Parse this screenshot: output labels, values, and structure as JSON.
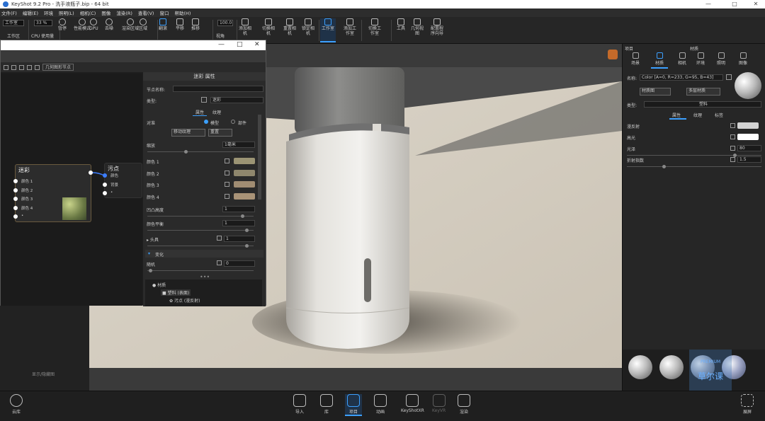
{
  "window": {
    "title": "KeyShot 9.2 Pro - 洗手液瓶子.bip - 64 bit"
  },
  "menu": [
    "文件(F)",
    "编辑(E)",
    "环境",
    "照明(L)",
    "相机(C)",
    "图像",
    "渲染(R)",
    "查看(V)",
    "窗口",
    "帮助(H)"
  ],
  "toolbar": {
    "workspace_label": "工作室",
    "workspace_value": "工作区",
    "cpu_value": "33 %",
    "cpu_label": "CPU 使用量",
    "items": [
      {
        "label": "暂停",
        "icon": "pause-icon"
      },
      {
        "label": "性能模式",
        "icon": "performance-icon"
      },
      {
        "label": "GPU",
        "icon": "gpu-icon"
      },
      {
        "label": "去噪",
        "icon": "denoise-icon"
      },
      {
        "label": "渲染区域",
        "icon": "region-icon"
      },
      {
        "label": "区域",
        "icon": "area-icon"
      },
      {
        "label": "翻滚",
        "icon": "tumble-icon"
      },
      {
        "label": "平移",
        "icon": "pan-icon"
      },
      {
        "label": "推移",
        "icon": "dolly-icon"
      }
    ],
    "fov_value": "100.0",
    "fov_label": "视角",
    "items2": [
      {
        "label": "添加相机",
        "icon": "add-camera-icon"
      },
      {
        "label": "切换相机",
        "icon": "switch-camera-icon"
      },
      {
        "label": "重置相机",
        "icon": "reset-camera-icon"
      },
      {
        "label": "锁定相机",
        "icon": "lock-camera-icon"
      },
      {
        "label": "工作室",
        "icon": "studio-icon"
      },
      {
        "label": "添加工作室",
        "icon": "add-studio-icon"
      },
      {
        "label": "切换工作室",
        "icon": "switch-studio-icon"
      },
      {
        "label": "工具",
        "icon": "tools-icon"
      },
      {
        "label": "几何视图",
        "icon": "geometry-view-icon"
      },
      {
        "label": "配置程序向导",
        "icon": "configurator-icon"
      }
    ]
  },
  "node_window": {
    "toolbar_label": "几何图形节点",
    "node_main": {
      "title": "迷彩",
      "ports": [
        "颜色 1",
        "颜色 2",
        "颜色 3",
        "颜色 4",
        "•"
      ]
    },
    "node_out": {
      "title": "污点",
      "ports": [
        "颜色",
        "背景",
        "•"
      ]
    },
    "footer": "显示/隐藏图"
  },
  "props": {
    "header": "迷彩 属性",
    "node_name_label": "节点名称:",
    "type_label": "类型:",
    "type_value": "迷彩",
    "tabs": [
      "属性",
      "纹理"
    ],
    "map_label": "对准",
    "radio1": "模型",
    "radio2": "部件",
    "move_btn": "移动纹理",
    "reset_btn": "重置",
    "scale_label": "缩放",
    "scale_value": "1毫米",
    "colors": [
      {
        "label": "颜色 1",
        "hex": "#9b9474"
      },
      {
        "label": "颜色 2",
        "hex": "#8f876d"
      },
      {
        "label": "颜色 3",
        "hex": "#a08c72"
      },
      {
        "label": "颜色 4",
        "hex": "#a99377"
      }
    ],
    "bump_label": "凹凸高度",
    "bump_value": "1",
    "color_balance_label": "颜色平衡",
    "color_balance_value": "1",
    "block_label": "▸ 头具",
    "block_value": "1",
    "change_label": "变化",
    "change_sub": "随机",
    "change_value": "0",
    "tree": [
      "材质",
      "塑料 (表面)",
      "污点 (漫反射)"
    ]
  },
  "right": {
    "header_left": "项目",
    "header_title": "材质",
    "tabs": [
      "场景",
      "材质",
      "相机",
      "环境",
      "照明",
      "图像"
    ],
    "name_label": "名称:",
    "name_value": "Color [A=0, R=233, G=95, B=43]",
    "btn1": "材质图",
    "btn2": "多层材质",
    "type_label": "类型:",
    "type_value": "塑料",
    "subtabs": [
      "属性",
      "纹理",
      "标签"
    ],
    "rows": [
      {
        "label": "漫反射",
        "value": ""
      },
      {
        "label": "高光",
        "value": ""
      },
      {
        "label": "光泽",
        "value": "80"
      },
      {
        "label": "折射指数",
        "value": "1.5"
      }
    ],
    "diffuse_color": "#d3d3d3",
    "specular_color": "#ffffff"
  },
  "bottom": {
    "left_label": "云库",
    "right_label": "展屏",
    "items": [
      {
        "label": "导入",
        "icon": "import-icon"
      },
      {
        "label": "库",
        "icon": "library-icon"
      },
      {
        "label": "项目",
        "icon": "project-icon"
      },
      {
        "label": "动画",
        "icon": "animation-icon"
      },
      {
        "label": "KeyShotXR",
        "icon": "keyshotxr-icon"
      },
      {
        "label": "KeyVR",
        "icon": "keyvr-icon"
      },
      {
        "label": "渲染",
        "icon": "render-icon"
      }
    ]
  },
  "watermark": {
    "text": "草尔课",
    "sub": "PREMIUM"
  }
}
